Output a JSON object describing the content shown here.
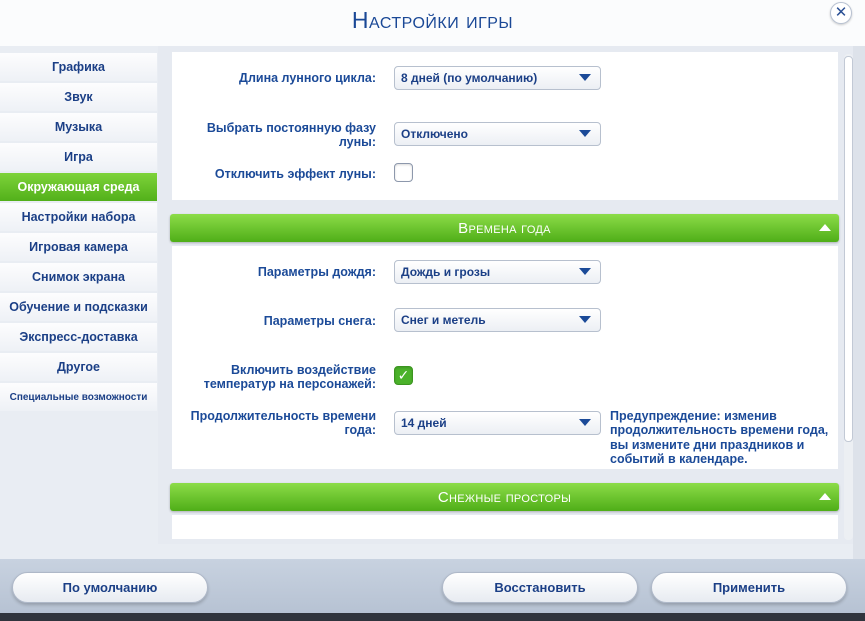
{
  "window": {
    "title": "Настройки игры",
    "close_label": "✕"
  },
  "sidebar": {
    "items": [
      {
        "label": "Графика"
      },
      {
        "label": "Звук"
      },
      {
        "label": "Музыка"
      },
      {
        "label": "Игра"
      },
      {
        "label": "Окружающая среда",
        "active": true
      },
      {
        "label": "Настройки набора"
      },
      {
        "label": "Игровая камера"
      },
      {
        "label": "Снимок экрана"
      },
      {
        "label": "Обучение и подсказки"
      },
      {
        "label": "Экспресс-доставка"
      },
      {
        "label": "Другое"
      },
      {
        "label": "Специальные возможности"
      }
    ]
  },
  "moon": {
    "cycle_label": "Длина лунного цикла:",
    "cycle_value": "8 дней (по умолчанию)",
    "phase_label": "Выбрать постоянную фазу луны:",
    "phase_value": "Отключено",
    "disable_effect_label": "Отключить эффект луны:",
    "disable_effect_checked": false
  },
  "seasons": {
    "header": "Времена года",
    "rain_label": "Параметры дождя:",
    "rain_value": "Дождь и грозы",
    "snow_label": "Параметры снега:",
    "snow_value": "Снег и метель",
    "temperature_label": "Включить воздействие температур на персонажей:",
    "temperature_checked": true,
    "duration_label": "Продолжительность времени года:",
    "duration_value": "14 дней",
    "warning": "Предупреждение: изменив продолжительность времени года, вы измените дни праздников и событий в календаре."
  },
  "snowy": {
    "header": "Снежные просторы"
  },
  "footer": {
    "default_label": "По умолчанию",
    "restore_label": "Восстановить",
    "apply_label": "Применить"
  },
  "colors": {
    "accent_green": "#52b01a",
    "text_blue": "#1b4a98"
  }
}
